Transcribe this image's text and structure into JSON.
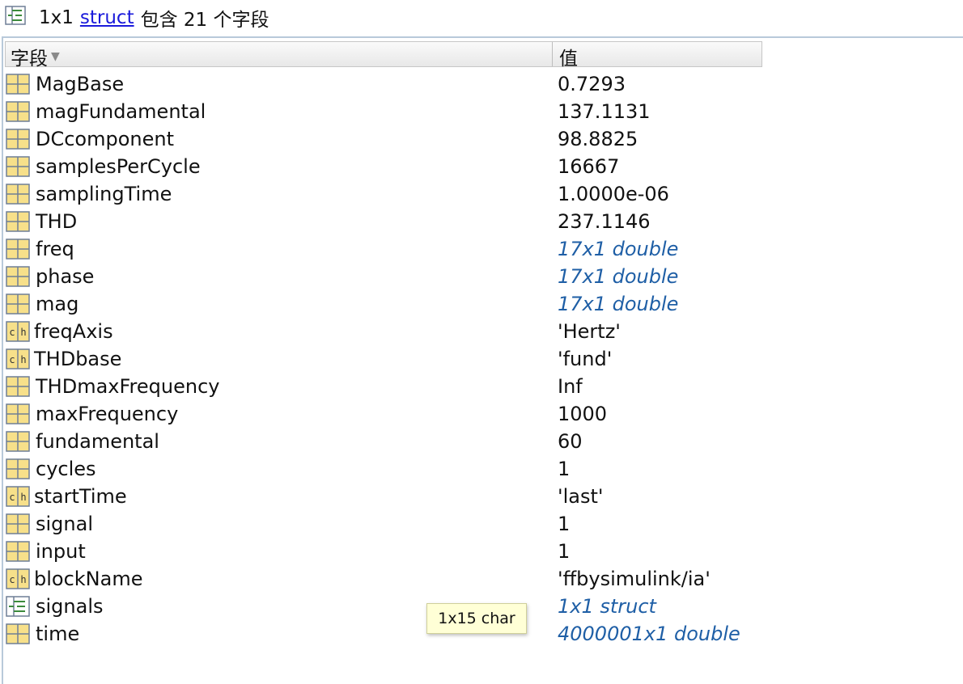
{
  "header": {
    "size": "1x1",
    "link": "struct",
    "suffix": "包含 21 个字段"
  },
  "columns": {
    "field": "字段",
    "value": "值"
  },
  "rows": [
    {
      "name": "MagBase",
      "value": "0.7293",
      "icon": "numeric-array-icon",
      "italic": false
    },
    {
      "name": "magFundamental",
      "value": "137.1131",
      "icon": "numeric-array-icon",
      "italic": false
    },
    {
      "name": "DCcomponent",
      "value": "98.8825",
      "icon": "numeric-array-icon",
      "italic": false
    },
    {
      "name": "samplesPerCycle",
      "value": "16667",
      "icon": "numeric-array-icon",
      "italic": false
    },
    {
      "name": "samplingTime",
      "value": "1.0000e-06",
      "icon": "numeric-array-icon",
      "italic": false
    },
    {
      "name": "THD",
      "value": "237.1146",
      "icon": "numeric-array-icon",
      "italic": false
    },
    {
      "name": "freq",
      "value": "17x1 double",
      "icon": "numeric-array-icon",
      "italic": true
    },
    {
      "name": "phase",
      "value": "17x1 double",
      "icon": "numeric-array-icon",
      "italic": true
    },
    {
      "name": "mag",
      "value": "17x1 double",
      "icon": "numeric-array-icon",
      "italic": true
    },
    {
      "name": "freqAxis",
      "value": "'Hertz'",
      "icon": "char-icon",
      "italic": false
    },
    {
      "name": "THDbase",
      "value": "'fund'",
      "icon": "char-icon",
      "italic": false
    },
    {
      "name": "THDmaxFrequency",
      "value": "Inf",
      "icon": "numeric-array-icon",
      "italic": false
    },
    {
      "name": "maxFrequency",
      "value": "1000",
      "icon": "numeric-array-icon",
      "italic": false
    },
    {
      "name": "fundamental",
      "value": "60",
      "icon": "numeric-array-icon",
      "italic": false
    },
    {
      "name": "cycles",
      "value": "1",
      "icon": "numeric-array-icon",
      "italic": false
    },
    {
      "name": "startTime",
      "value": "'last'",
      "icon": "char-icon",
      "italic": false
    },
    {
      "name": "signal",
      "value": "1",
      "icon": "numeric-array-icon",
      "italic": false
    },
    {
      "name": "input",
      "value": "1",
      "icon": "numeric-array-icon",
      "italic": false
    },
    {
      "name": "blockName",
      "value": "'ffbysimulink/ia'",
      "icon": "char-icon",
      "italic": false
    },
    {
      "name": "signals",
      "value": "1x1 struct",
      "icon": "struct-icon",
      "italic": true
    },
    {
      "name": "time",
      "value": "4000001x1 double",
      "icon": "numeric-array-icon",
      "italic": true
    }
  ],
  "tooltip": "1x15 char",
  "colors": {
    "link": "#1a1adb",
    "italic_value": "#1f5fa6",
    "icon_fill": "#f7e08a",
    "icon_grid": "#6f7f96"
  }
}
